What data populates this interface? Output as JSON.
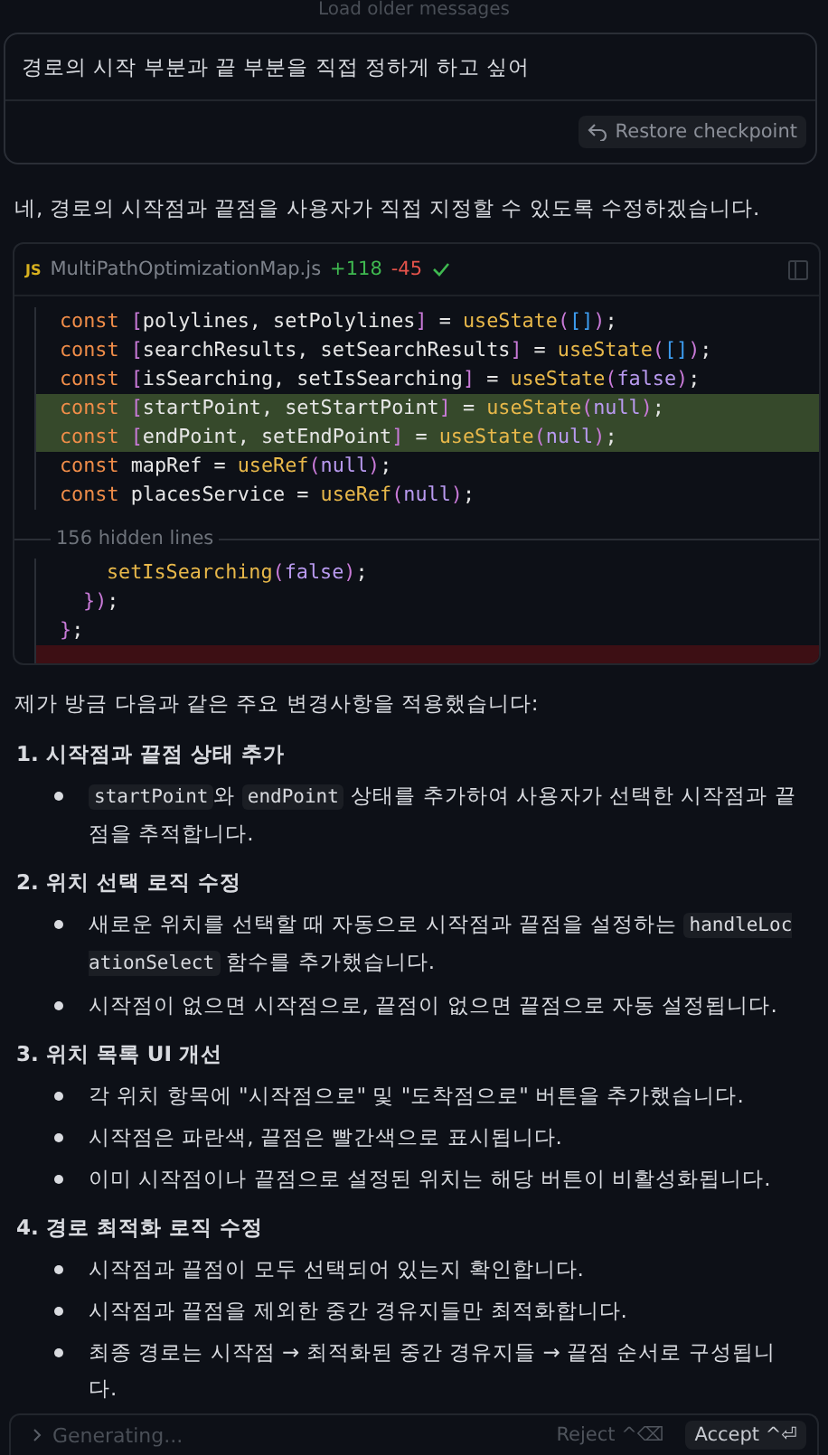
{
  "load_older": "Load older messages",
  "user_message": {
    "text": "경로의 시작 부분과 끝 부분을 직접 정하게 하고 싶어",
    "restore_button": "Restore checkpoint"
  },
  "reply_intro": "네, 경로의 시작점과 끝점을 사용자가 직접 지정할 수 있도록 수정하겠습니다.",
  "code_card": {
    "file_badge": "JS",
    "filename": "MultiPathOptimizationMap.js",
    "added": "+118",
    "removed": "-45",
    "lines": [
      {
        "kind": "context",
        "text": "const [polylines, setPolylines] = useState([]);"
      },
      {
        "kind": "context",
        "text": "const [searchResults, setSearchResults] = useState([]);"
      },
      {
        "kind": "context",
        "text": "const [isSearching, setIsSearching] = useState(false);"
      },
      {
        "kind": "added",
        "text": "const [startPoint, setStartPoint] = useState(null);"
      },
      {
        "kind": "added",
        "text": "const [endPoint, setEndPoint] = useState(null);"
      },
      {
        "kind": "context",
        "text": "const mapRef = useRef(null);"
      },
      {
        "kind": "context",
        "text": "const placesService = useRef(null);"
      }
    ],
    "hidden_lines": "156 hidden lines",
    "tail_lines": [
      {
        "kind": "context",
        "text": "setIsSearching(false);"
      },
      {
        "kind": "context",
        "text": "});"
      },
      {
        "kind": "context",
        "text": "};"
      },
      {
        "kind": "removed"
      }
    ]
  },
  "summary_intro": "제가 방금 다음과 같은 주요 변경사항을 적용했습니다:",
  "sections": [
    {
      "heading": "1. 시작점과 끝점 상태 추가",
      "items": [
        [
          {
            "t": "startPoint",
            "code": true
          },
          {
            "t": "와 ",
            "code": false
          },
          {
            "t": "endPoint",
            "code": true
          },
          {
            "t": " 상태를 추가하여 사용자가 선택한 시작점과 끝점을 추적합니다.",
            "code": false
          }
        ]
      ]
    },
    {
      "heading": "2. 위치 선택 로직 수정",
      "items": [
        [
          {
            "t": "새로운 위치를 선택할 때 자동으로 시작점과 끝점을 설정하는 ",
            "code": false
          },
          {
            "t": "handleLocationSelect",
            "code": true
          },
          {
            "t": " 함수를 추가했습니다.",
            "code": false
          }
        ],
        [
          {
            "t": "시작점이 없으면 시작점으로, 끝점이 없으면 끝점으로 자동 설정됩니다.",
            "code": false
          }
        ]
      ]
    },
    {
      "heading": "3. 위치 목록 UI 개선",
      "items": [
        [
          {
            "t": "각 위치 항목에 \"시작점으로\" 및 \"도착점으로\" 버튼을 추가했습니다.",
            "code": false
          }
        ],
        [
          {
            "t": "시작점은 파란색, 끝점은 빨간색으로 표시됩니다.",
            "code": false
          }
        ],
        [
          {
            "t": "이미 시작점이나 끝점으로 설정된 위치는 해당 버튼이 비활성화됩니다.",
            "code": false
          }
        ]
      ]
    },
    {
      "heading": "4. 경로 최적화 로직 수정",
      "items": [
        [
          {
            "t": "시작점과 끝점이 모두 선택되어 있는지 확인합니다.",
            "code": false
          }
        ],
        [
          {
            "t": "시작점과 끝점을 제외한 중간 경유지들만 최적화합니다.",
            "code": false
          }
        ],
        [
          {
            "t": "최종 경로는 시작점 → 최적화된 중간 경유지들 → 끝점 순서로 구성됩니다.",
            "code": false
          }
        ]
      ]
    }
  ],
  "footer": {
    "status": "Generating...",
    "reject": "Reject ^⌫",
    "accept": "Accept ^⏎"
  }
}
